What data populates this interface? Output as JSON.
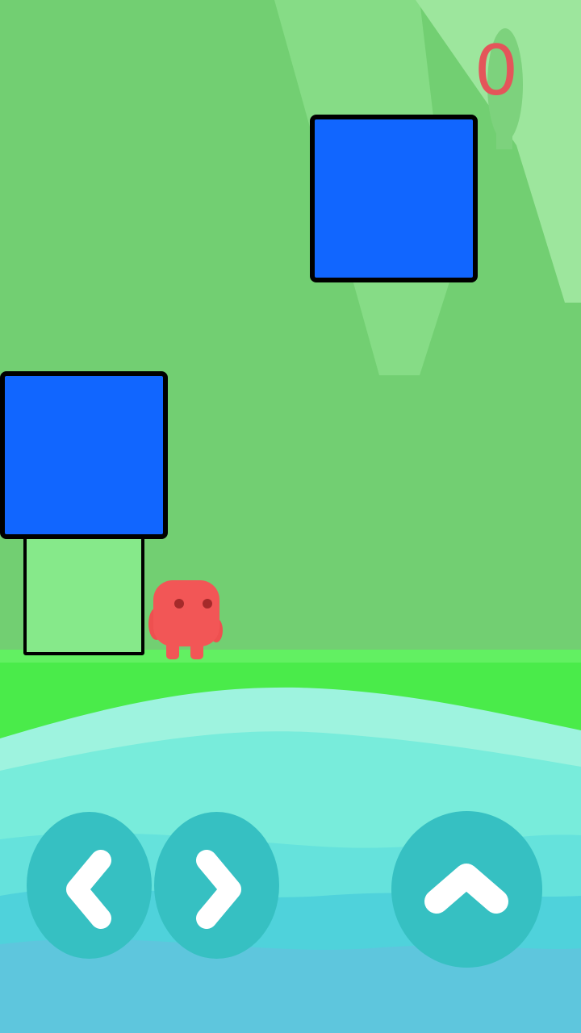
{
  "hud": {
    "score": "0"
  },
  "scene": {
    "sky_color": "#72cf72",
    "block_color": "#1166ff",
    "ghost_block_color": "#86e98a",
    "grass_color": "#4aeb4a",
    "water_colors": [
      "#9ef3df",
      "#78ecdb",
      "#4fd2db",
      "#5ec6dd"
    ],
    "player_color": "#f25656"
  },
  "controls": {
    "left": {
      "icon": "chevron-left-icon"
    },
    "right": {
      "icon": "chevron-right-icon"
    },
    "jump": {
      "icon": "chevron-up-icon"
    },
    "button_color": "#36c0c2"
  }
}
